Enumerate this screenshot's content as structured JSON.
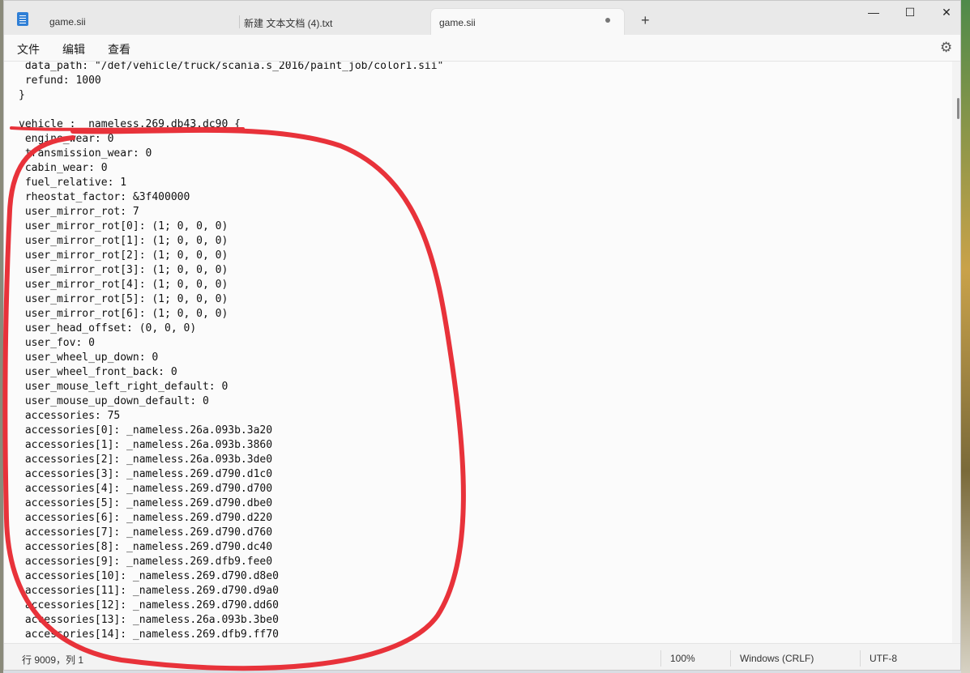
{
  "tabs": [
    {
      "label": "game.sii"
    },
    {
      "label": "新建 文本文档 (4).txt"
    },
    {
      "label": "game.sii",
      "active": true,
      "unsaved": true
    }
  ],
  "window_controls": {
    "minimize": "—",
    "maximize": "☐",
    "close": "✕",
    "new_tab": "+"
  },
  "menu": {
    "file": "文件",
    "edit": "编辑",
    "view": "查看"
  },
  "icons": {
    "settings": "gear-icon",
    "app": "notepad-icon"
  },
  "editor": {
    "lines": [
      " data_path: \"/def/vehicle/truck/scania.s_2016/paint_job/color1.sii\"",
      " refund: 1000",
      "}",
      "",
      "vehicle : _nameless.269.db43.dc90 {",
      " engine_wear: 0",
      " transmission_wear: 0",
      " cabin_wear: 0",
      " fuel_relative: 1",
      " rheostat_factor: &3f400000",
      " user_mirror_rot: 7",
      " user_mirror_rot[0]: (1; 0, 0, 0)",
      " user_mirror_rot[1]: (1; 0, 0, 0)",
      " user_mirror_rot[2]: (1; 0, 0, 0)",
      " user_mirror_rot[3]: (1; 0, 0, 0)",
      " user_mirror_rot[4]: (1; 0, 0, 0)",
      " user_mirror_rot[5]: (1; 0, 0, 0)",
      " user_mirror_rot[6]: (1; 0, 0, 0)",
      " user_head_offset: (0, 0, 0)",
      " user_fov: 0",
      " user_wheel_up_down: 0",
      " user_wheel_front_back: 0",
      " user_mouse_left_right_default: 0",
      " user_mouse_up_down_default: 0",
      " accessories: 75",
      " accessories[0]: _nameless.26a.093b.3a20",
      " accessories[1]: _nameless.26a.093b.3860",
      " accessories[2]: _nameless.26a.093b.3de0",
      " accessories[3]: _nameless.269.d790.d1c0",
      " accessories[4]: _nameless.269.d790.d700",
      " accessories[5]: _nameless.269.d790.dbe0",
      " accessories[6]: _nameless.269.d790.d220",
      " accessories[7]: _nameless.269.d790.d760",
      " accessories[8]: _nameless.269.d790.dc40",
      " accessories[9]: _nameless.269.dfb9.fee0",
      " accessories[10]: _nameless.269.d790.d8e0",
      " accessories[11]: _nameless.269.d790.d9a0",
      " accessories[12]: _nameless.269.d790.dd60",
      " accessories[13]: _nameless.26a.093b.3be0",
      " accessories[14]: _nameless.269.dfb9.ff70"
    ]
  },
  "status": {
    "position": "行 9009，列 1",
    "zoom": "100%",
    "line_ending": "Windows (CRLF)",
    "encoding": "UTF-8"
  },
  "annotation_color": "#e8323a"
}
